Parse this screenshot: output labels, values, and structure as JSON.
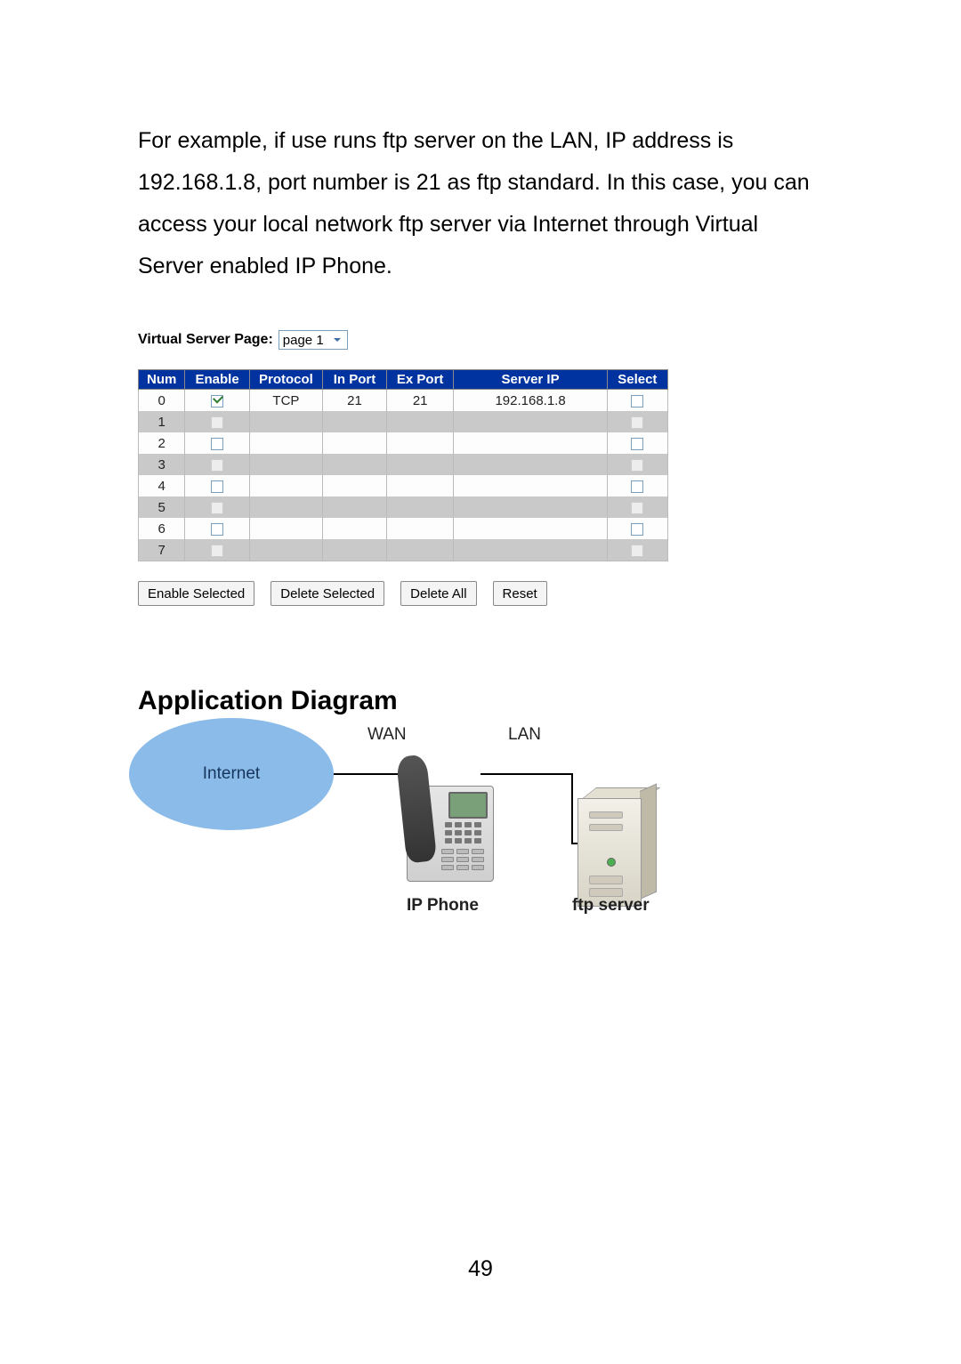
{
  "paragraph": "For example, if use runs ftp server on the LAN, IP address is 192.168.1.8, port number is 21 as ftp standard. In this case, you can access your local network ftp server via Internet through Virtual Server enabled IP Phone.",
  "virtual_server": {
    "label": "Virtual Server Page:",
    "page_selected": "page 1",
    "headers": {
      "num": "Num",
      "enable": "Enable",
      "protocol": "Protocol",
      "in_port": "In Port",
      "ex_port": "Ex Port",
      "server_ip": "Server IP",
      "select": "Select"
    },
    "rows": [
      {
        "num": "0",
        "enable_checked": true,
        "protocol": "TCP",
        "in_port": "21",
        "ex_port": "21",
        "server_ip": "192.168.1.8",
        "select_checked": false
      },
      {
        "num": "1",
        "enable_checked": false,
        "protocol": "",
        "in_port": "",
        "ex_port": "",
        "server_ip": "",
        "select_checked": false
      },
      {
        "num": "2",
        "enable_checked": false,
        "protocol": "",
        "in_port": "",
        "ex_port": "",
        "server_ip": "",
        "select_checked": false
      },
      {
        "num": "3",
        "enable_checked": false,
        "protocol": "",
        "in_port": "",
        "ex_port": "",
        "server_ip": "",
        "select_checked": false
      },
      {
        "num": "4",
        "enable_checked": false,
        "protocol": "",
        "in_port": "",
        "ex_port": "",
        "server_ip": "",
        "select_checked": false
      },
      {
        "num": "5",
        "enable_checked": false,
        "protocol": "",
        "in_port": "",
        "ex_port": "",
        "server_ip": "",
        "select_checked": false
      },
      {
        "num": "6",
        "enable_checked": false,
        "protocol": "",
        "in_port": "",
        "ex_port": "",
        "server_ip": "",
        "select_checked": false
      },
      {
        "num": "7",
        "enable_checked": false,
        "protocol": "",
        "in_port": "",
        "ex_port": "",
        "server_ip": "",
        "select_checked": false
      }
    ],
    "buttons": {
      "enable_selected": "Enable Selected",
      "delete_selected": "Delete Selected",
      "delete_all": "Delete All",
      "reset": "Reset"
    }
  },
  "section_heading": "Application Diagram",
  "diagram": {
    "internet": "Internet",
    "wan": "WAN",
    "lan": "LAN",
    "ip_phone": "IP Phone",
    "ftp_server": "ftp server"
  },
  "page_number": "49"
}
